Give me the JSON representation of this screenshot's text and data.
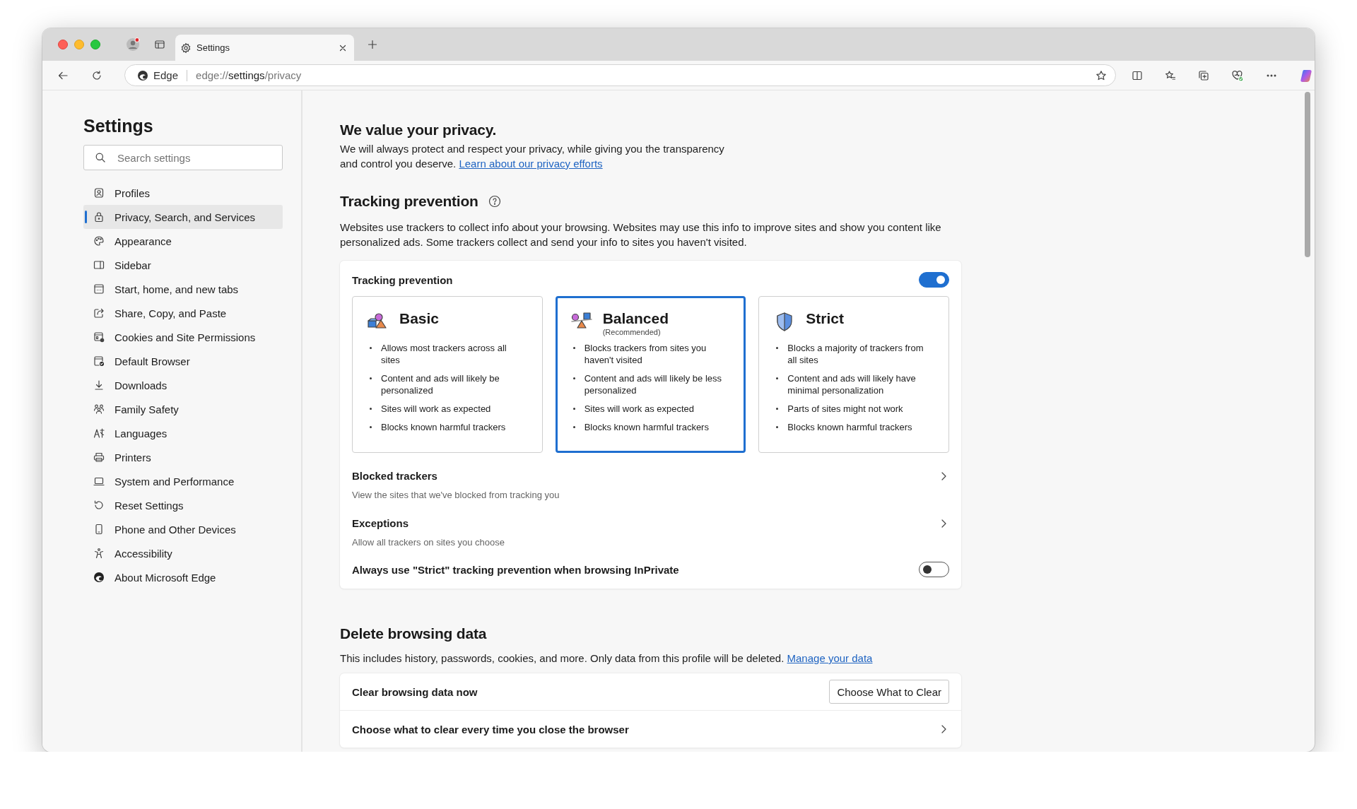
{
  "tabs": [
    {
      "title": "Settings",
      "selected": true
    }
  ],
  "address_bar": {
    "site": "Edge",
    "url_scheme": "edge://",
    "url_host": "settings",
    "url_path": "/privacy"
  },
  "sidebar": {
    "title": "Settings",
    "search": {
      "placeholder": "Search settings"
    },
    "items": [
      {
        "label": "Profiles",
        "selected": false
      },
      {
        "label": "Privacy, Search, and Services",
        "selected": true
      },
      {
        "label": "Appearance",
        "selected": false
      },
      {
        "label": "Sidebar",
        "selected": false
      },
      {
        "label": "Start, home, and new tabs",
        "selected": false
      },
      {
        "label": "Share, Copy, and Paste",
        "selected": false
      },
      {
        "label": "Cookies and Site Permissions",
        "selected": false
      },
      {
        "label": "Default Browser",
        "selected": false
      },
      {
        "label": "Downloads",
        "selected": false
      },
      {
        "label": "Family Safety",
        "selected": false
      },
      {
        "label": "Languages",
        "selected": false
      },
      {
        "label": "Printers",
        "selected": false
      },
      {
        "label": "System and Performance",
        "selected": false
      },
      {
        "label": "Reset Settings",
        "selected": false
      },
      {
        "label": "Phone and Other Devices",
        "selected": false
      },
      {
        "label": "Accessibility",
        "selected": false
      },
      {
        "label": "About Microsoft Edge",
        "selected": false
      }
    ]
  },
  "privacy_intro": {
    "title": "We value your privacy.",
    "text": "We will always protect and respect your privacy, while giving you the transparency and control you deserve.",
    "link": "Learn about our privacy efforts"
  },
  "tracking_prevention": {
    "title": "Tracking prevention",
    "description": "Websites use trackers to collect info about your browsing. Websites may use this info to improve sites and show you content like personalized ads. Some trackers collect and send your info to sites you haven't visited.",
    "panel": {
      "title": "Tracking prevention",
      "on": true,
      "levels": [
        {
          "name": "Basic",
          "selected": false,
          "points": [
            "Allows most trackers across all sites",
            "Content and ads will likely be personalized",
            "Sites will work as expected",
            "Blocks known harmful trackers"
          ]
        },
        {
          "name": "Balanced",
          "note": "(Recommended)",
          "selected": true,
          "points": [
            "Blocks trackers from sites you haven't visited",
            "Content and ads will likely be less personalized",
            "Sites will work as expected",
            "Blocks known harmful trackers"
          ]
        },
        {
          "name": "Strict",
          "selected": false,
          "points": [
            "Blocks a majority of trackers from all sites",
            "Content and ads will likely have minimal personalization",
            "Parts of sites might not work",
            "Blocks known harmful trackers"
          ]
        }
      ],
      "rows": [
        {
          "kind": "link",
          "title": "Blocked trackers",
          "subtitle": "View the sites that we've blocked from tracking you"
        },
        {
          "kind": "link",
          "title": "Exceptions",
          "subtitle": "Allow all trackers on sites you choose"
        },
        {
          "kind": "toggle",
          "title": "Always use \"Strict\" tracking prevention when browsing InPrivate",
          "on": false
        }
      ]
    }
  },
  "delete_browsing_data": {
    "title": "Delete browsing data",
    "text": "This includes history, passwords, cookies, and more. Only data from this profile will be deleted.",
    "link": "Manage your data",
    "rows": [
      {
        "kind": "button",
        "title": "Clear browsing data now",
        "button": "Choose What to Clear"
      },
      {
        "kind": "link",
        "title": "Choose what to clear every time you close the browser"
      }
    ]
  }
}
